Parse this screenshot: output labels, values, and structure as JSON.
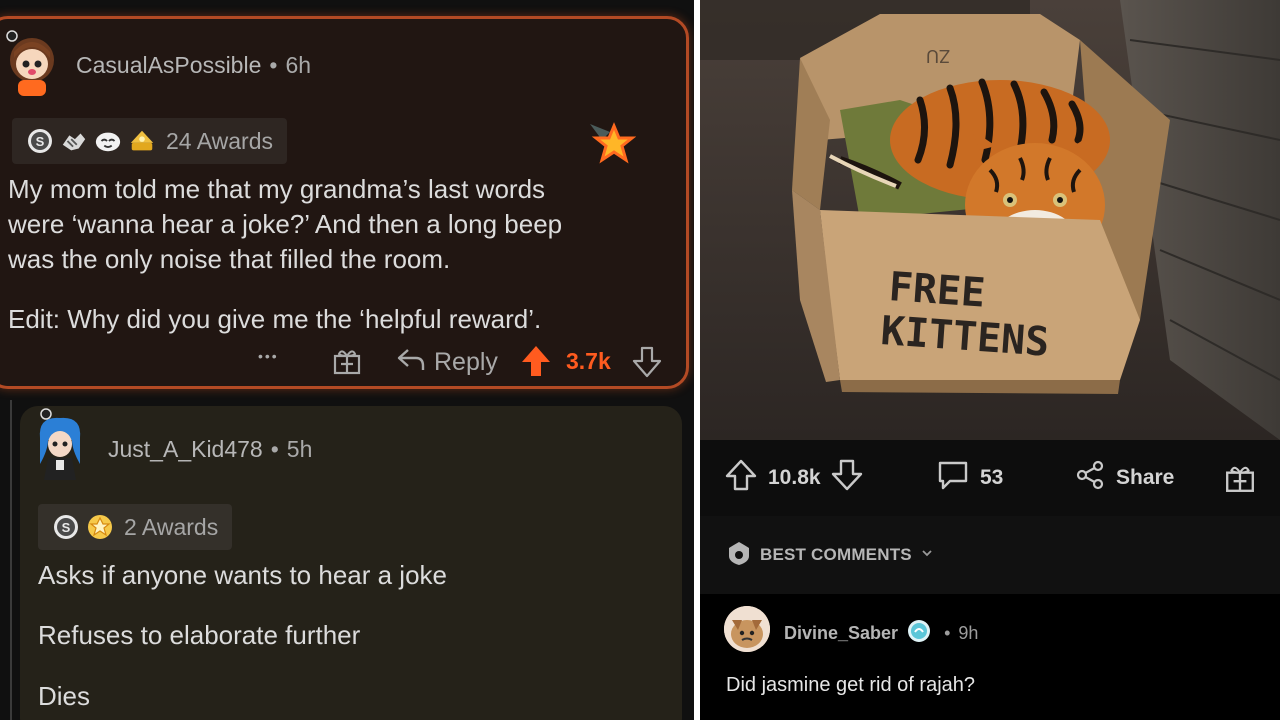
{
  "left_panel": {
    "comment1": {
      "username": "CasualAsPossible",
      "separator": "•",
      "age": "6h",
      "awards_label": "24 Awards",
      "body": [
        "My mom told me that my grandma’s last words",
        "were ‘wanna hear a joke?’ And then a long beep",
        "was the only noise that filled the room."
      ],
      "edit": "Edit: Why did you give me the ‘helpful reward’.",
      "more_label": "•••",
      "reply_label": "Reply",
      "score": "3.7k"
    },
    "comment2": {
      "username": "Just_A_Kid478",
      "separator": "•",
      "age": "5h",
      "awards_label": "2 Awards",
      "lines": [
        "Asks if anyone wants to hear a joke",
        "Refuses to elaborate further",
        "Dies"
      ]
    }
  },
  "right_panel": {
    "photo": {
      "sign_line1": "FREE",
      "sign_line2": "KITTENS",
      "box_marking": "ZU"
    },
    "post_actions": {
      "score": "10.8k",
      "comments": "53",
      "share_label": "Share"
    },
    "sort_label": "BEST COMMENTS",
    "top_comment": {
      "username": "Divine_Saber",
      "separator": "•",
      "age": "9h",
      "text": "Did jasmine get rid of rajah?"
    }
  },
  "colors": {
    "accent_orange": "#ff5b1f",
    "comment_border": "#b34a24",
    "comment1_bg": "#211612",
    "comment2_bg": "#252219"
  },
  "icons": [
    "silver-award-icon",
    "handshake-award-icon",
    "wholesome-award-icon",
    "gold-award-icon",
    "star-award-icon",
    "gift-icon",
    "reply-arrow-icon",
    "upvote-arrow-icon",
    "downvote-arrow-icon",
    "comment-bubble-icon",
    "share-icon",
    "mod-shield-icon",
    "chevron-down-icon"
  ]
}
